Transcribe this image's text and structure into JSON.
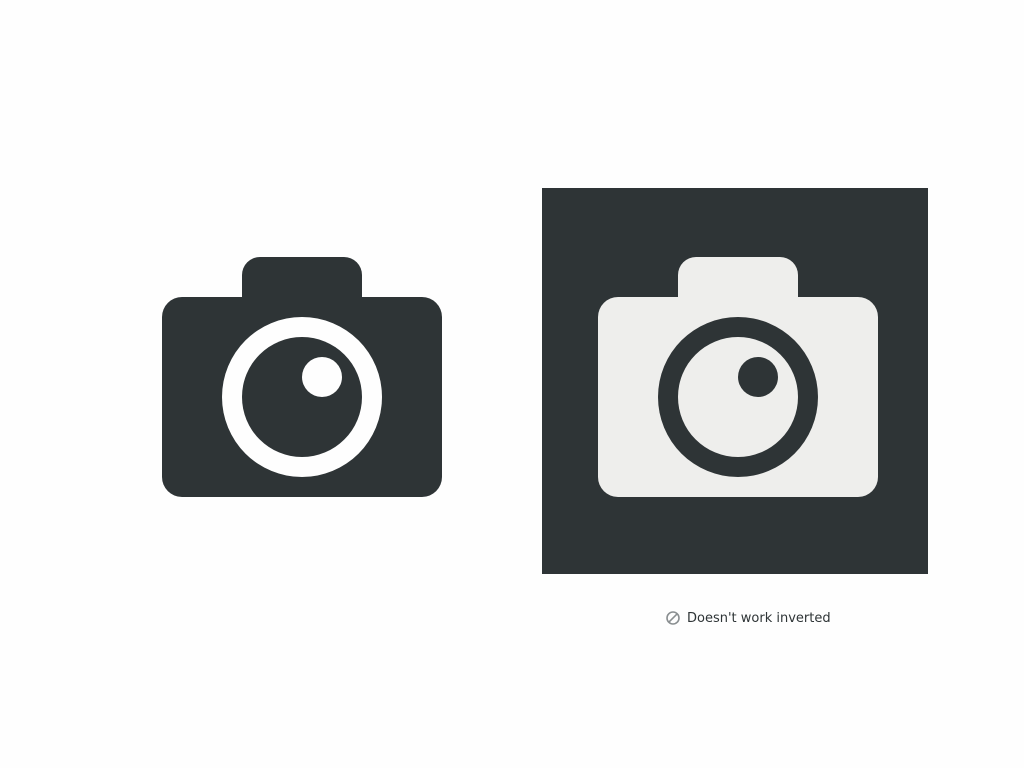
{
  "icons": {
    "normal": {
      "name": "camera-icon"
    },
    "inverted": {
      "name": "camera-icon"
    },
    "caption_icon": {
      "name": "not-allowed-icon"
    }
  },
  "caption": {
    "text": "Doesn't work inverted"
  },
  "colors": {
    "dark": "#2e3436",
    "light": "#eeeeec",
    "page_background": "#fefefe",
    "muted_icon": "#8a8f91"
  }
}
